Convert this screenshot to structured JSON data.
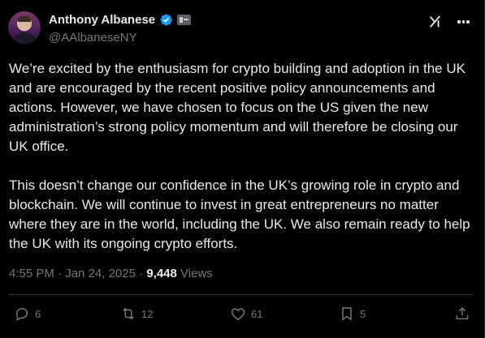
{
  "tweet": {
    "author": {
      "display_name": "Anthony Albanese",
      "handle": "@AAlbaneseNY",
      "verified": true
    },
    "body": [
      "We’re excited by the enthusiasm for crypto building and adoption in the UK and are encouraged by the recent positive policy announcements and actions. However, we have chosen to focus on the US given the new administration’s strong policy momentum and will therefore be closing our UK office.",
      "This doesn’t change our confidence in the UK’s growing role in crypto and blockchain. We will continue to invest in great entrepreneurs no matter where they are in the world, including the UK. We also remain ready to help the UK with its ongoing crypto efforts."
    ],
    "meta": {
      "time": "4:55 PM",
      "separator1": "·",
      "date": "Jan 24, 2025",
      "separator2": "·",
      "views_count": "9,448",
      "views_label": "Views"
    },
    "actions": {
      "replies": "6",
      "reposts": "12",
      "likes": "61",
      "bookmarks": "5"
    }
  },
  "icons": {
    "verified": "verified-badge-icon",
    "affiliate": "affiliation-badge-icon",
    "grok": "grok-icon",
    "more": "more-options-icon",
    "reply": "reply-bubble-icon",
    "repost": "repost-arrows-icon",
    "like": "heart-icon",
    "bookmark": "bookmark-icon",
    "share": "share-upload-icon"
  },
  "colors": {
    "background": "#000000",
    "text": "#e7e9ea",
    "secondary_text": "#71767b",
    "verified_blue": "#1d9bf0",
    "divider": "#2f3336"
  }
}
